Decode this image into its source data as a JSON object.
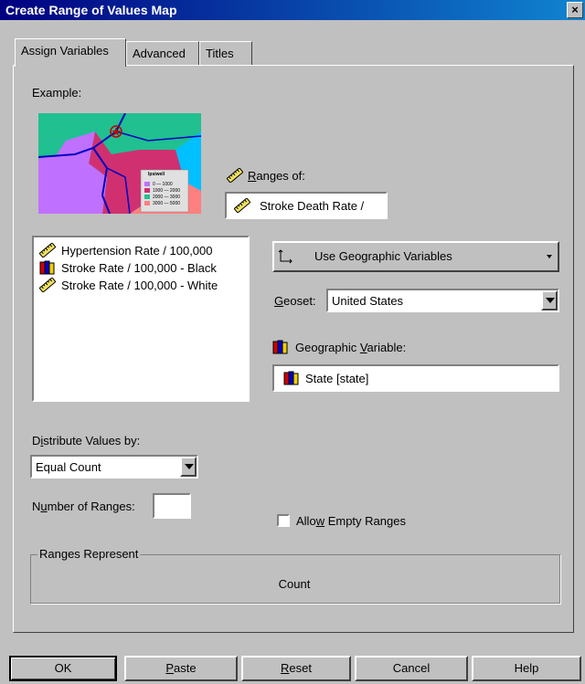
{
  "window": {
    "title": "Create Range of Values Map",
    "close_label": "×"
  },
  "tabs": [
    {
      "label": "Assign Variables",
      "active": true
    },
    {
      "label": "Advanced",
      "active": false
    },
    {
      "label": "Titles",
      "active": false
    }
  ],
  "example": {
    "label": "Example:",
    "legend_title": "Ipsiwell",
    "legend_items": [
      "0 — 1000",
      "1000 — 2000",
      "2000 — 3000",
      "3000 — 5000"
    ]
  },
  "ranges_of": {
    "label_pre": "",
    "label_u": "R",
    "label_post": "anges of:",
    "value": "Stroke Death Rate /"
  },
  "variable_list": [
    {
      "label": "Hypertension Rate / 100,000",
      "icon": "ruler-icon"
    },
    {
      "label": "Stroke Rate / 100,000 - Black",
      "icon": "books-icon"
    },
    {
      "label": "Stroke Rate / 100,000 - White",
      "icon": "ruler-icon"
    }
  ],
  "geo_dropdown": {
    "label": "Use Geographic Variables"
  },
  "geoset": {
    "label_pre": "",
    "label_u": "G",
    "label_post": "eoset:",
    "value": "United States"
  },
  "geographic_variable": {
    "label_pre": "Geographic ",
    "label_u": "V",
    "label_post": "ariable:",
    "value": "State [state]"
  },
  "distribute": {
    "label_pre": "D",
    "label_u": "i",
    "label_post": "stribute Values by:",
    "value": "Equal Count"
  },
  "number_of_ranges": {
    "label_pre": "N",
    "label_u": "u",
    "label_post": "mber of Ranges:",
    "value": ""
  },
  "allow_empty": {
    "label_pre": "Allo",
    "label_u": "w",
    "label_post": " Empty Ranges",
    "checked": false
  },
  "ranges_represent": {
    "legend": "Ranges Represent",
    "value": "Count"
  },
  "buttons": {
    "ok": "OK",
    "paste_u": "P",
    "paste_rest": "aste",
    "reset_u": "R",
    "reset_rest": "eset",
    "cancel": "Cancel",
    "help": "Help"
  },
  "colors": {
    "title_bar": "#000080",
    "dialog": "#c0c0c0"
  }
}
